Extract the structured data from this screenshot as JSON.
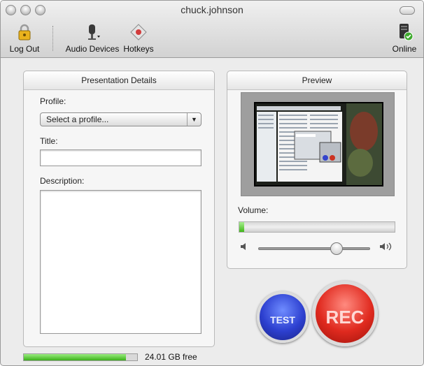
{
  "window": {
    "title": "chuck.johnson"
  },
  "toolbar": {
    "items": [
      {
        "label": "Log Out",
        "icon": "padlock-icon"
      },
      {
        "label": "Audio Devices",
        "icon": "microphone-icon"
      },
      {
        "label": "Hotkeys",
        "icon": "diamond-key-icon"
      },
      {
        "label": "Online",
        "icon": "server-online-icon"
      }
    ]
  },
  "details": {
    "heading": "Presentation Details",
    "profile_label": "Profile:",
    "profile_value": "Select a profile...",
    "title_label": "Title:",
    "title_value": "",
    "description_label": "Description:",
    "description_value": ""
  },
  "preview": {
    "heading": "Preview",
    "volume_label": "Volume:",
    "input_level": 0.03,
    "volume_level": 0.7
  },
  "buttons": {
    "test_label": "TEST",
    "rec_label": "REC"
  },
  "disk": {
    "used_fraction": 0.9,
    "free_text": "24.01 GB free"
  },
  "colors": {
    "accent_green": "#41b71a",
    "rec_red": "#e02a1f",
    "test_blue": "#2d40d0"
  }
}
